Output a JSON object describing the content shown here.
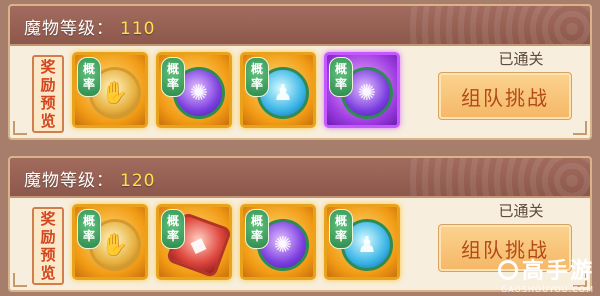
{
  "panels": [
    {
      "level_label": "魔物等级：",
      "level_value": "110",
      "reward_preview": [
        "奖",
        "励",
        "预",
        "览"
      ],
      "items": [
        {
          "rarity": "gold",
          "orb": "gold",
          "icon": "hand-armor-icon",
          "glyph": "✋"
        },
        {
          "rarity": "gold",
          "orb": "violet",
          "icon": "violet-swirl-icon",
          "glyph": "✺"
        },
        {
          "rarity": "gold",
          "orb": "cyan",
          "icon": "warrior-silhouette-icon",
          "glyph": "♟"
        },
        {
          "rarity": "purple",
          "orb": "violet",
          "icon": "violet-swirl-icon",
          "glyph": "✺"
        }
      ],
      "status": "已通关",
      "button_label": "组队挑战"
    },
    {
      "level_label": "魔物等级：",
      "level_value": "120",
      "reward_preview": [
        "奖",
        "励",
        "预",
        "览"
      ],
      "items": [
        {
          "rarity": "gold",
          "orb": "gold",
          "icon": "hand-armor-icon",
          "glyph": "✋"
        },
        {
          "rarity": "gold",
          "orb": "red",
          "icon": "red-crystal-icon",
          "glyph": "◆"
        },
        {
          "rarity": "gold",
          "orb": "violet",
          "icon": "violet-swirl-icon",
          "glyph": "✺"
        },
        {
          "rarity": "gold",
          "orb": "cyan",
          "icon": "warrior-silhouette-icon",
          "glyph": "♟"
        }
      ],
      "status": "已通关",
      "button_label": "组队挑战"
    }
  ],
  "chance_tag": [
    "概",
    "率"
  ],
  "watermark": {
    "main": "高手游",
    "sub": "GAOSHOUYOU.COM"
  },
  "colors": {
    "gold_frame": "#e9a21b",
    "purple_frame": "#c658ff",
    "level_number": "#ffe04e",
    "button_text": "#b44a1a"
  }
}
